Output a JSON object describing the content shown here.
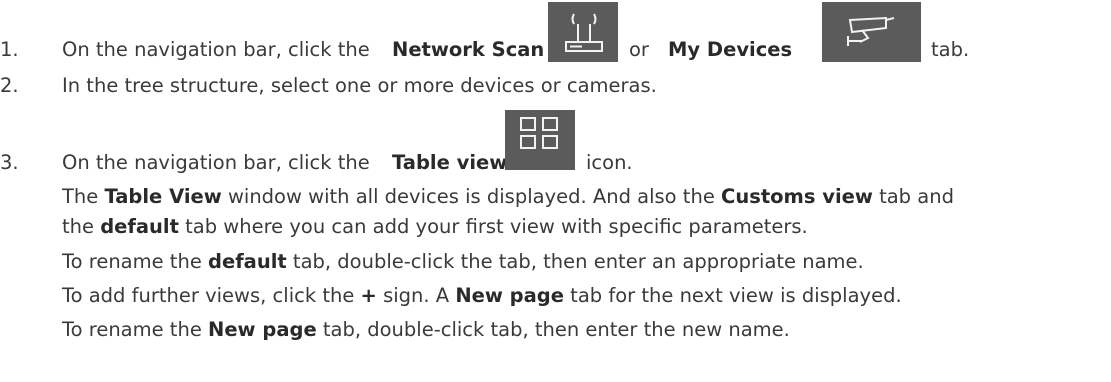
{
  "step1": {
    "num": "1.",
    "pre": "On the navigation bar, click the",
    "bold1": "Network Scan",
    "mid": "or",
    "bold2": "My Devices",
    "post": "tab.",
    "icon1": "network-scan-icon",
    "icon2": "my-devices-icon",
    "icon_bg": "#5b5b5b"
  },
  "step2": {
    "num": "2.",
    "text": "In the tree structure, select one or more devices or cameras."
  },
  "step3": {
    "num": "3.",
    "pre": "On the navigation bar, click the",
    "bold": "Table view",
    "post": "icon.",
    "icon": "table-view-icon",
    "paras": [
      {
        "a": "The ",
        "b": "Table View",
        "c": " window with all devices is displayed. And also the ",
        "d": "Customs view",
        "e": " tab and"
      },
      {
        "a": "the ",
        "b": "default",
        "c": " tab where you can add your first view with specific parameters."
      },
      {
        "a": "To rename the ",
        "b": "default",
        "c": " tab, double-click the tab, then enter an appropriate name."
      },
      {
        "a": "To add further views, click the ",
        "b": "+",
        "c": " sign. A ",
        "d": "New page",
        "e": " tab for the next view is displayed."
      },
      {
        "a": "To rename the ",
        "b": "New page",
        "c": " tab, double-click tab, then enter the new name."
      }
    ]
  }
}
